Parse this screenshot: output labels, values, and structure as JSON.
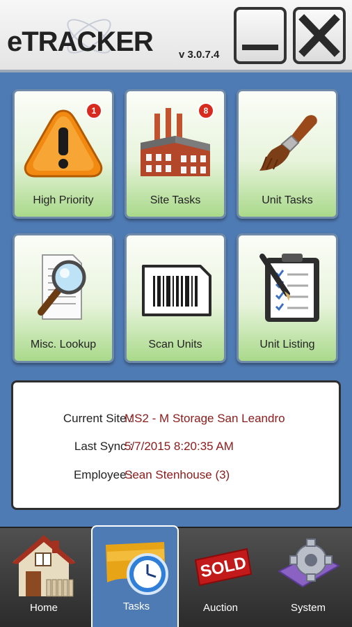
{
  "app": {
    "title": "eTRACKER",
    "version": "v 3.0.7.4"
  },
  "window_controls": {
    "minimize_icon": "minimize-icon",
    "close_icon": "close-icon"
  },
  "tiles": [
    {
      "label": "High Priority",
      "icon": "warning-icon",
      "badge": "1"
    },
    {
      "label": "Site Tasks",
      "icon": "factory-icon",
      "badge": "8"
    },
    {
      "label": "Unit Tasks",
      "icon": "paintbrush-icon"
    },
    {
      "label": "Misc. Lookup",
      "icon": "magnifier-document-icon"
    },
    {
      "label": "Scan Units",
      "icon": "barcode-icon"
    },
    {
      "label": "Unit Listing",
      "icon": "clipboard-checklist-icon"
    }
  ],
  "info": {
    "current_site": {
      "label": "Current Site :",
      "value": "MS2 - M Storage San Leandro"
    },
    "last_sync": {
      "label": "Last Sync :",
      "value": "5/7/2015 8:20:35 AM"
    },
    "employee": {
      "label": "Employee :",
      "value": "Sean Stenhouse (3)"
    }
  },
  "nav": [
    {
      "label": "Home",
      "icon": "house-icon"
    },
    {
      "label": "Tasks",
      "icon": "clock-icon",
      "active": true
    },
    {
      "label": "Auction",
      "icon": "sold-sign-icon"
    },
    {
      "label": "System",
      "icon": "gear-icon"
    }
  ],
  "colors": {
    "background": "#4f7bb4",
    "value_text": "#8b1a1a",
    "badge": "#d82b1f"
  }
}
